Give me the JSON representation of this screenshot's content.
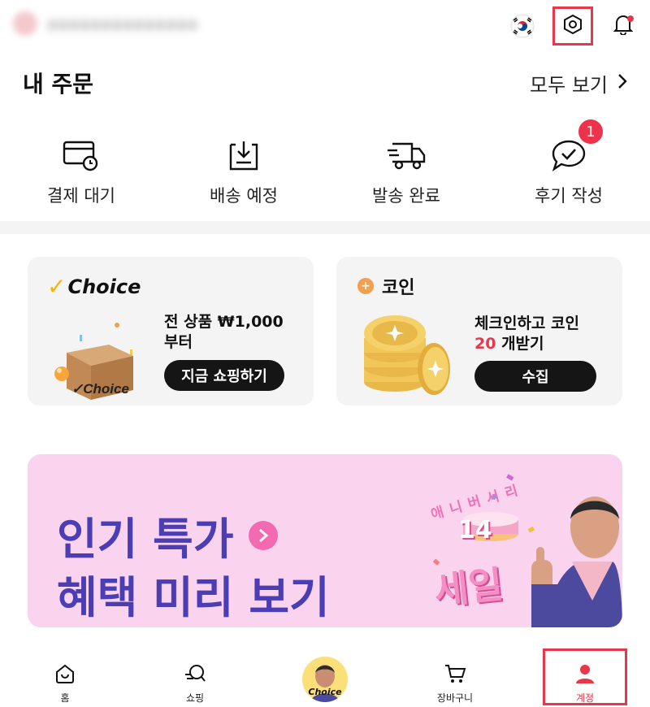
{
  "header": {
    "blurred_name": "aaaaaaaaaaaaaa",
    "icons": [
      "korea-flag-icon",
      "settings-icon",
      "bell-icon"
    ]
  },
  "orders": {
    "title": "내 주문",
    "see_all": "모두 보기",
    "items": [
      {
        "label": "결제 대기",
        "icon": "pending-payment-icon"
      },
      {
        "label": "배송 예정",
        "icon": "to-ship-icon"
      },
      {
        "label": "발송 완료",
        "icon": "shipped-icon"
      },
      {
        "label": "후기 작성",
        "icon": "review-icon",
        "badge": "1"
      }
    ]
  },
  "choice_card": {
    "logo": "Choice",
    "box_text": "✓Choice",
    "text": "전 상품 ₩1,000 부터",
    "button": "지금 쇼핑하기"
  },
  "coin_card": {
    "title": "코인",
    "text_line1": "체크인하고 코인",
    "count": "20",
    "text_line2_suffix": " 개받기",
    "button": "수집"
  },
  "banner": {
    "line1": "인기 특가",
    "line2": "혜택 미리 보기",
    "anniversary": "애니버서리",
    "number": "14",
    "sale": "세일"
  },
  "bottom_nav": [
    {
      "label": "홈",
      "icon": "home-icon"
    },
    {
      "label": "쇼핑",
      "icon": "shopping-icon"
    },
    {
      "label": "Choice",
      "icon": "choice-avatar"
    },
    {
      "label": "장바구니",
      "icon": "cart-icon"
    },
    {
      "label": "계정",
      "icon": "account-icon",
      "active": true
    }
  ],
  "colors": {
    "accent": "#e8374b",
    "banner_bg": "#fad4ef",
    "banner_text": "#4b3db3",
    "choice_yellow": "#f7b500"
  }
}
